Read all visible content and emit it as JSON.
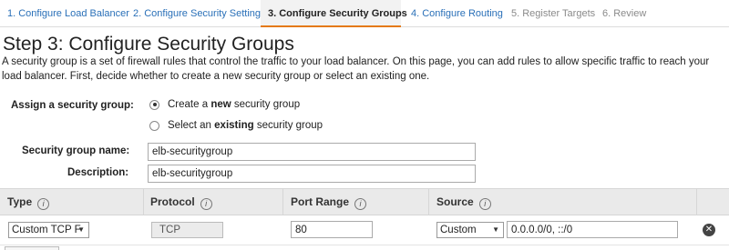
{
  "wizard": {
    "steps": [
      {
        "label": "1. Configure Load Balancer",
        "state": "done"
      },
      {
        "label": "2. Configure Security Settings",
        "state": "done"
      },
      {
        "label": "3. Configure Security Groups",
        "state": "active"
      },
      {
        "label": "4. Configure Routing",
        "state": "next"
      },
      {
        "label": "5. Register Targets",
        "state": "todo"
      },
      {
        "label": "6. Review",
        "state": "todo"
      }
    ]
  },
  "page": {
    "title": "Step 3: Configure Security Groups",
    "intro": "A security group is a set of firewall rules that control the traffic to your load balancer. On this page, you can add rules to allow specific traffic to reach your load balancer. First, decide whether to create a new security group or select an existing one."
  },
  "form": {
    "assign_label": "Assign a security group:",
    "option_create_pre": "Create a ",
    "option_create_bold": "new",
    "option_create_post": " security group",
    "option_existing_pre": "Select an ",
    "option_existing_bold": "existing",
    "option_existing_post": " security group",
    "selected_option": "create",
    "name_label": "Security group name:",
    "name_value": "elb-securitygroup",
    "desc_label": "Description:",
    "desc_value": "elb-securitygroup"
  },
  "rules_table": {
    "headers": {
      "type": "Type",
      "protocol": "Protocol",
      "port_range": "Port Range",
      "source": "Source"
    },
    "info_glyph": "i",
    "rows": [
      {
        "type": "Custom TCP F",
        "protocol": "TCP",
        "port_range": "80",
        "source_mode": "Custom",
        "source_value": "0.0.0.0/0, ::/0"
      }
    ],
    "remove_icon": "remove-icon"
  },
  "colors": {
    "link": "#2a70b8",
    "active_tab_accent": "#e47911",
    "header_bg": "#eaeaea"
  }
}
